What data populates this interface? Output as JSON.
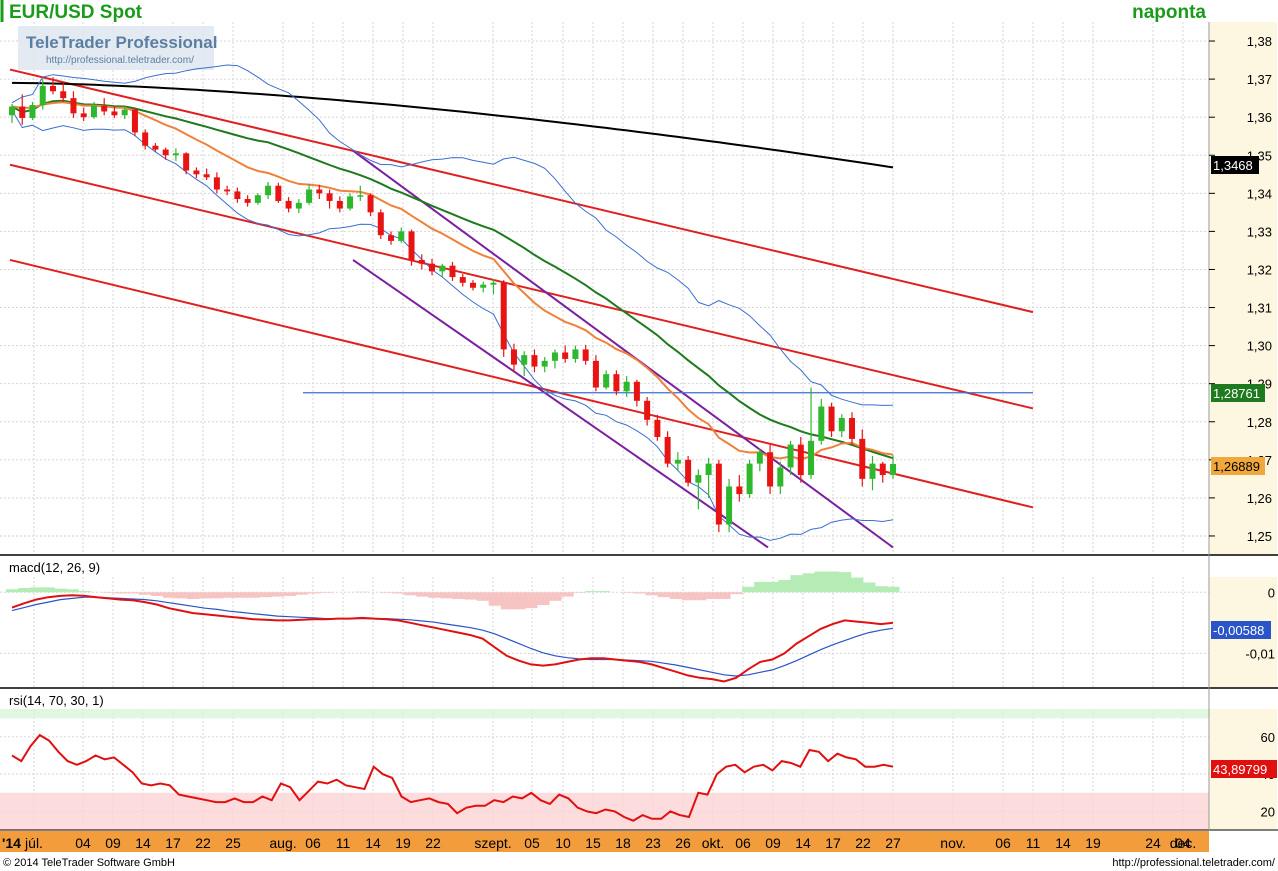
{
  "header": {
    "title": "EUR/USD Spot",
    "period": "naponta"
  },
  "watermark": {
    "brand": "TeleTrader Professional",
    "url": "http://professional.teletrader.com/"
  },
  "footer": {
    "copyright": "© 2014 TeleTrader Software GmbH",
    "url": "http://professional.teletrader.com/"
  },
  "colors": {
    "up": "#2db82d",
    "down": "#e81414",
    "channel": "#e02020",
    "purple": "#7a1fa0",
    "sma_long": "#000000",
    "sma_green": "#1e7a1e",
    "ema_orange": "#f0813a",
    "bollinger": "#3a6fd0",
    "hline": "#3a6fd0",
    "macd": "#e01010",
    "signal": "#2a55c8",
    "rsi": "#e01010",
    "axis_bg": "#fdf6e0",
    "xaxis_bg": "#f39c3c"
  },
  "chart_data": [
    {
      "type": "candlestick",
      "panel": "price",
      "ylim": [
        1.245,
        1.385
      ],
      "yticks": [
        "1,38",
        "1,37",
        "1,36",
        "1,35",
        "1,34",
        "1,33",
        "1,32",
        "1,31",
        "1,30",
        "1,29",
        "1,28",
        "1,27",
        "1,26",
        "1,25"
      ],
      "xticks": [
        "'14",
        "júl.",
        "04",
        "09",
        "14",
        "17",
        "22",
        "25",
        "aug.",
        "06",
        "11",
        "14",
        "19",
        "22",
        "szept.",
        "05",
        "10",
        "15",
        "18",
        "23",
        "26",
        "okt.",
        "06",
        "09",
        "14",
        "17",
        "22",
        "27",
        "nov.",
        "06",
        "11",
        "14",
        "19",
        "24",
        "dec.",
        "04"
      ],
      "candles": [
        [
          1.3605,
          1.3635,
          1.3585,
          1.3628
        ],
        [
          1.3628,
          1.366,
          1.358,
          1.3598
        ],
        [
          1.3598,
          1.364,
          1.3592,
          1.3632
        ],
        [
          1.3632,
          1.37,
          1.362,
          1.3682
        ],
        [
          1.3682,
          1.3705,
          1.366,
          1.3668
        ],
        [
          1.3668,
          1.369,
          1.364,
          1.365
        ],
        [
          1.365,
          1.3668,
          1.3598,
          1.361
        ],
        [
          1.361,
          1.3625,
          1.359,
          1.36
        ],
        [
          1.36,
          1.364,
          1.3596,
          1.363
        ],
        [
          1.363,
          1.365,
          1.3605,
          1.3615
        ],
        [
          1.3615,
          1.3628,
          1.3598,
          1.3605
        ],
        [
          1.3605,
          1.3628,
          1.3595,
          1.362
        ],
        [
          1.362,
          1.3625,
          1.355,
          1.356
        ],
        [
          1.356,
          1.3568,
          1.3515,
          1.3525
        ],
        [
          1.3525,
          1.3532,
          1.351,
          1.3515
        ],
        [
          1.3515,
          1.352,
          1.3488,
          1.35
        ],
        [
          1.35,
          1.3518,
          1.3485,
          1.3505
        ],
        [
          1.3505,
          1.3508,
          1.345,
          1.346
        ],
        [
          1.346,
          1.3468,
          1.344,
          1.345
        ],
        [
          1.345,
          1.3465,
          1.3435,
          1.3442
        ],
        [
          1.3442,
          1.3455,
          1.34,
          1.341
        ],
        [
          1.341,
          1.342,
          1.3395,
          1.3405
        ],
        [
          1.3405,
          1.3415,
          1.3375,
          1.3385
        ],
        [
          1.3385,
          1.3395,
          1.3365,
          1.3375
        ],
        [
          1.3375,
          1.34,
          1.337,
          1.3395
        ],
        [
          1.3395,
          1.343,
          1.3385,
          1.342
        ],
        [
          1.342,
          1.3428,
          1.3375,
          1.338
        ],
        [
          1.338,
          1.339,
          1.335,
          1.336
        ],
        [
          1.336,
          1.3385,
          1.3348,
          1.3375
        ],
        [
          1.3375,
          1.3425,
          1.337,
          1.341
        ],
        [
          1.341,
          1.3422,
          1.3385,
          1.34
        ],
        [
          1.34,
          1.341,
          1.336,
          1.338
        ],
        [
          1.338,
          1.3392,
          1.335,
          1.336
        ],
        [
          1.336,
          1.34,
          1.3355,
          1.3392
        ],
        [
          1.3392,
          1.342,
          1.338,
          1.3395
        ],
        [
          1.3395,
          1.34,
          1.334,
          1.335
        ],
        [
          1.335,
          1.3358,
          1.328,
          1.329
        ],
        [
          1.329,
          1.33,
          1.3265,
          1.3275
        ],
        [
          1.3275,
          1.331,
          1.327,
          1.33
        ],
        [
          1.33,
          1.3305,
          1.321,
          1.3225
        ],
        [
          1.3225,
          1.324,
          1.32,
          1.3215
        ],
        [
          1.3215,
          1.3228,
          1.3185,
          1.3195
        ],
        [
          1.3195,
          1.3215,
          1.318,
          1.321
        ],
        [
          1.321,
          1.322,
          1.317,
          1.318
        ],
        [
          1.318,
          1.3188,
          1.3155,
          1.3165
        ],
        [
          1.3165,
          1.3172,
          1.3145,
          1.3152
        ],
        [
          1.3152,
          1.3168,
          1.314,
          1.316
        ],
        [
          1.316,
          1.3175,
          1.3135,
          1.3165
        ],
        [
          1.3165,
          1.3172,
          1.297,
          1.299
        ],
        [
          1.299,
          1.3005,
          1.293,
          1.295
        ],
        [
          1.295,
          1.2985,
          1.292,
          1.2975
        ],
        [
          1.2975,
          1.299,
          1.293,
          1.2945
        ],
        [
          1.2945,
          1.297,
          1.293,
          1.296
        ],
        [
          1.296,
          1.299,
          1.294,
          1.2982
        ],
        [
          1.2982,
          1.3,
          1.2955,
          1.2965
        ],
        [
          1.2965,
          1.3,
          1.2955,
          1.299
        ],
        [
          1.299,
          1.3002,
          1.295,
          1.296
        ],
        [
          1.296,
          1.2975,
          1.288,
          1.289
        ],
        [
          1.289,
          1.2935,
          1.2885,
          1.2925
        ],
        [
          1.2925,
          1.2935,
          1.287,
          1.288
        ],
        [
          1.288,
          1.292,
          1.2865,
          1.2905
        ],
        [
          1.2905,
          1.291,
          1.284,
          1.2855
        ],
        [
          1.2855,
          1.2865,
          1.279,
          1.2805
        ],
        [
          1.2805,
          1.2818,
          1.275,
          1.276
        ],
        [
          1.276,
          1.2775,
          1.268,
          1.269
        ],
        [
          1.269,
          1.272,
          1.267,
          1.27
        ],
        [
          1.27,
          1.271,
          1.263,
          1.264
        ],
        [
          1.264,
          1.2675,
          1.257,
          1.266
        ],
        [
          1.266,
          1.2705,
          1.26,
          1.269
        ],
        [
          1.269,
          1.27,
          1.251,
          1.253
        ],
        [
          1.253,
          1.265,
          1.251,
          1.263
        ],
        [
          1.263,
          1.266,
          1.259,
          1.261
        ],
        [
          1.261,
          1.27,
          1.26,
          1.269
        ],
        [
          1.269,
          1.273,
          1.267,
          1.272
        ],
        [
          1.272,
          1.274,
          1.261,
          1.263
        ],
        [
          1.263,
          1.2695,
          1.261,
          1.268
        ],
        [
          1.268,
          1.275,
          1.266,
          1.274
        ],
        [
          1.274,
          1.276,
          1.264,
          1.266
        ],
        [
          1.266,
          1.289,
          1.265,
          1.275
        ],
        [
          1.275,
          1.286,
          1.274,
          1.284
        ],
        [
          1.284,
          1.285,
          1.276,
          1.2775
        ],
        [
          1.2775,
          1.282,
          1.276,
          1.281
        ],
        [
          1.281,
          1.2825,
          1.274,
          1.2755
        ],
        [
          1.2755,
          1.278,
          1.263,
          1.265
        ],
        [
          1.265,
          1.271,
          1.262,
          1.269
        ],
        [
          1.269,
          1.2695,
          1.264,
          1.266
        ],
        [
          1.266,
          1.2712,
          1.265,
          1.2689
        ]
      ],
      "hline": 1.28761,
      "price_labels": [
        "1,3468",
        "1,28761",
        "1,26889"
      ]
    },
    {
      "type": "line",
      "panel": "macd",
      "title": "macd(12, 26, 9)",
      "ylim": [
        -0.0155,
        0.0025
      ],
      "yticks": [
        "0",
        "-0,01"
      ],
      "label_values": [
        "-0,00588"
      ],
      "macd": [
        -0.0025,
        -0.0018,
        -0.0012,
        -0.0008,
        -0.0006,
        -0.0005,
        -0.0006,
        -0.0008,
        -0.001,
        -0.0012,
        -0.0013,
        -0.0016,
        -0.002,
        -0.0026,
        -0.003,
        -0.0034,
        -0.0036,
        -0.0038,
        -0.004,
        -0.0042,
        -0.0044,
        -0.0045,
        -0.0046,
        -0.0046,
        -0.0045,
        -0.0044,
        -0.0044,
        -0.0043,
        -0.0043,
        -0.0042,
        -0.0043,
        -0.0044,
        -0.0046,
        -0.005,
        -0.0054,
        -0.0058,
        -0.0062,
        -0.0066,
        -0.007,
        -0.0076,
        -0.009,
        -0.0104,
        -0.0112,
        -0.0118,
        -0.012,
        -0.0118,
        -0.0114,
        -0.011,
        -0.0108,
        -0.0108,
        -0.011,
        -0.0112,
        -0.0114,
        -0.0118,
        -0.0124,
        -0.013,
        -0.0136,
        -0.014,
        -0.0142,
        -0.0146,
        -0.014,
        -0.0126,
        -0.0114,
        -0.011,
        -0.01,
        -0.0084,
        -0.0072,
        -0.006,
        -0.0052,
        -0.0046,
        -0.0048,
        -0.005,
        -0.0052,
        -0.005
      ],
      "signal": [
        -0.003,
        -0.0025,
        -0.002,
        -0.0016,
        -0.0012,
        -0.001,
        -0.0008,
        -0.0008,
        -0.0009,
        -0.001,
        -0.0011,
        -0.0012,
        -0.0014,
        -0.0017,
        -0.002,
        -0.0023,
        -0.0026,
        -0.0028,
        -0.0031,
        -0.0033,
        -0.0035,
        -0.0037,
        -0.0039,
        -0.004,
        -0.0041,
        -0.0042,
        -0.0043,
        -0.0043,
        -0.0043,
        -0.0043,
        -0.0043,
        -0.0043,
        -0.0044,
        -0.0045,
        -0.0047,
        -0.0049,
        -0.0052,
        -0.0055,
        -0.0058,
        -0.0062,
        -0.0068,
        -0.0076,
        -0.0084,
        -0.0092,
        -0.0099,
        -0.0104,
        -0.0107,
        -0.0109,
        -0.011,
        -0.011,
        -0.011,
        -0.0111,
        -0.0112,
        -0.0113,
        -0.0116,
        -0.0119,
        -0.0123,
        -0.0127,
        -0.0131,
        -0.0135,
        -0.0137,
        -0.0135,
        -0.0131,
        -0.0127,
        -0.012,
        -0.0112,
        -0.0103,
        -0.0094,
        -0.0086,
        -0.0079,
        -0.0072,
        -0.0066,
        -0.0062,
        -0.0059
      ],
      "hist": [
        0.0005,
        0.0007,
        0.0008,
        0.0008,
        0.0006,
        0.0005,
        0.0002,
        0.0,
        -0.0001,
        -0.0002,
        -0.0002,
        -0.0004,
        -0.0006,
        -0.0009,
        -0.001,
        -0.0011,
        -0.001,
        -0.001,
        -0.0009,
        -0.0009,
        -0.0009,
        -0.0008,
        -0.0007,
        -0.0006,
        -0.0004,
        -0.0002,
        -0.0001,
        0.0,
        0.0,
        0.0001,
        0.0,
        -0.0001,
        -0.0002,
        -0.0005,
        -0.0007,
        -0.0009,
        -0.001,
        -0.0011,
        -0.0012,
        -0.0014,
        -0.0022,
        -0.0028,
        -0.0028,
        -0.0026,
        -0.0021,
        -0.0014,
        -0.0007,
        -0.0001,
        0.0002,
        0.0002,
        0.0,
        -0.0001,
        -0.0002,
        -0.0005,
        -0.0008,
        -0.0011,
        -0.0013,
        -0.0013,
        -0.0011,
        -0.0011,
        -0.0003,
        0.0009,
        0.0017,
        0.0017,
        0.002,
        0.0028,
        0.0031,
        0.0034,
        0.0034,
        0.0033,
        0.0024,
        0.0016,
        0.001,
        0.0009
      ]
    },
    {
      "type": "line",
      "panel": "rsi",
      "title": "rsi(14, 70, 30, 1)",
      "ylim": [
        10,
        75
      ],
      "yticks": [
        "60",
        "40",
        "20"
      ],
      "label_values": [
        "43,89799"
      ],
      "bands": [
        70,
        30
      ],
      "values": [
        50,
        47,
        55,
        61,
        58,
        52,
        47,
        45,
        47,
        50,
        48,
        49,
        45,
        41,
        35,
        34,
        35,
        34,
        29,
        28,
        27,
        26,
        25,
        25,
        27,
        25,
        25,
        28,
        26,
        35,
        33,
        26,
        31,
        36,
        35,
        37,
        34,
        33,
        32,
        44,
        40,
        38,
        28,
        25,
        26,
        27,
        25,
        24,
        19,
        22,
        23,
        23,
        26,
        25,
        28,
        27,
        30,
        26,
        24,
        29,
        27,
        22,
        20,
        19,
        21,
        20,
        17,
        15,
        18,
        16,
        16,
        20,
        18,
        17,
        30,
        29,
        40,
        44,
        45,
        41,
        44,
        45,
        42,
        47,
        46,
        44,
        53,
        52,
        47,
        51,
        49,
        48,
        44,
        44,
        45,
        44
      ]
    }
  ]
}
